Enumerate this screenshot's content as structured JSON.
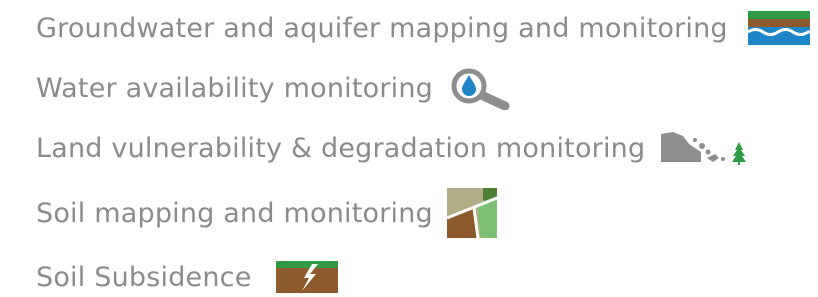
{
  "colors": {
    "text": "#8b8b8b",
    "green": "#2e9a45",
    "brown": "#8c5a2b",
    "blue": "#1e86c6",
    "gray": "#8e8e8e",
    "tan": "#b2ad86",
    "light_green": "#7dbf73",
    "dark_green": "#4f7e36"
  },
  "items": [
    {
      "label": "Groundwater and aquifer mapping and monitoring",
      "icon": "groundwater-layers-icon"
    },
    {
      "label": "Water availability monitoring",
      "icon": "water-drop-magnifier-icon"
    },
    {
      "label": "Land vulnerability & degradation monitoring",
      "icon": "landslide-tree-icon"
    },
    {
      "label": "Soil mapping and monitoring",
      "icon": "soil-map-tiles-icon"
    },
    {
      "label": "Soil Subsidence",
      "icon": "soil-crack-icon"
    }
  ]
}
